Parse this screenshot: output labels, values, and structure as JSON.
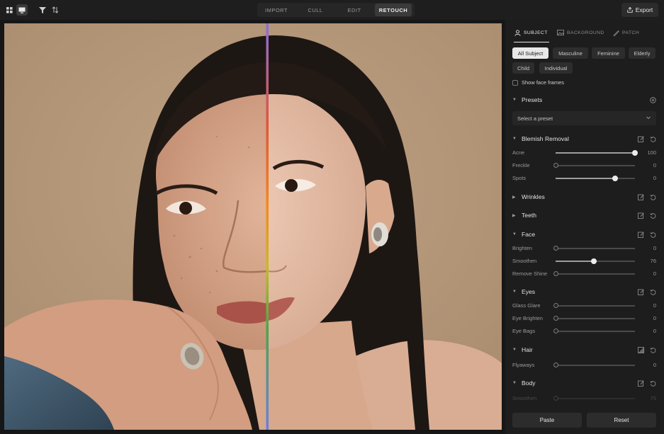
{
  "toolbar": {
    "modes": [
      {
        "label": "IMPORT",
        "active": false
      },
      {
        "label": "CULL",
        "active": false
      },
      {
        "label": "EDIT",
        "active": false
      },
      {
        "label": "RETOUCH",
        "active": true
      }
    ],
    "export_label": "Export",
    "icons": [
      "grid-view-icon",
      "single-view-icon",
      "filter-icon",
      "sort-icon",
      "export-icon"
    ]
  },
  "panel": {
    "tabs": [
      {
        "label": "SUBJECT",
        "active": true,
        "icon": "person-icon"
      },
      {
        "label": "BACKGROUND",
        "active": false,
        "icon": "image-icon"
      },
      {
        "label": "PATCH",
        "active": false,
        "icon": "patch-brush-icon"
      }
    ],
    "subject_filters": [
      "All Subject",
      "Masculine",
      "Feminine",
      "Elderly",
      "Child",
      "Individual"
    ],
    "active_filter": "All Subject",
    "show_face_frames_label": "Show face frames",
    "presets": {
      "title": "Presets",
      "placeholder": "Select a preset"
    },
    "sections": {
      "blemish": {
        "title": "Blemish Removal",
        "sliders": [
          {
            "label": "Acne",
            "value": "100",
            "fraction": 1.0,
            "active": true
          },
          {
            "label": "Freckle",
            "value": "0",
            "fraction": 0.0,
            "active": false
          },
          {
            "label": "Spots",
            "value": "0",
            "fraction": 0.75,
            "active": true
          }
        ]
      },
      "wrinkles": {
        "title": "Wrinkles"
      },
      "teeth": {
        "title": "Teeth"
      },
      "face": {
        "title": "Face",
        "sliders": [
          {
            "label": "Brighten",
            "value": "0",
            "fraction": 0.0,
            "active": false
          },
          {
            "label": "Smoothen",
            "value": "76",
            "fraction": 0.48,
            "active": true
          },
          {
            "label": "Remove Shine",
            "value": "0",
            "fraction": 0.0,
            "active": false
          }
        ]
      },
      "eyes": {
        "title": "Eyes",
        "sliders": [
          {
            "label": "Glass Glare",
            "value": "0",
            "fraction": 0.0,
            "active": false
          },
          {
            "label": "Eye Brighten",
            "value": "0",
            "fraction": 0.0,
            "active": false
          },
          {
            "label": "Eye Bags",
            "value": "0",
            "fraction": 0.0,
            "active": false
          }
        ]
      },
      "hair": {
        "title": "Hair",
        "sliders": [
          {
            "label": "Flyaways",
            "value": "0",
            "fraction": 0.0,
            "active": false
          }
        ]
      },
      "body": {
        "title": "Body",
        "sliders": [
          {
            "label": "Smoothen",
            "value": "75",
            "fraction": 0.0,
            "active": false
          }
        ]
      }
    },
    "paste_label": "Paste",
    "reset_label": "Reset"
  },
  "colors": {
    "background_wall": "#b89a7c",
    "split_line_top": "#8a6fd6",
    "split_line_mid": "#f28a1c",
    "split_line_low": "#4fa44a",
    "split_line_bottom": "#6a7fe0"
  }
}
